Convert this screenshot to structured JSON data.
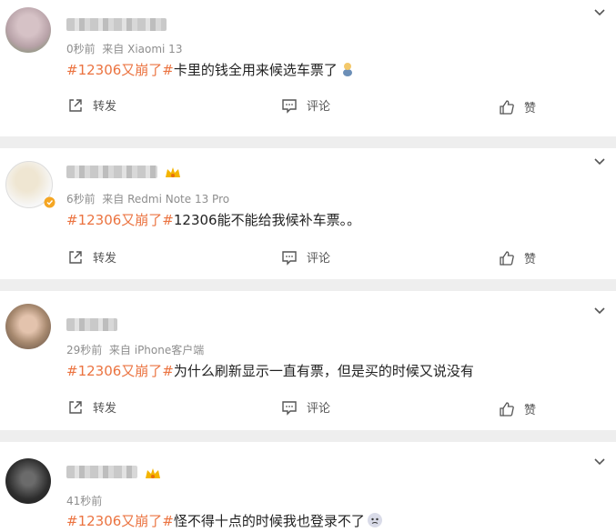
{
  "posts": [
    {
      "time": "0秒前",
      "source": "来自 Xiaomi 13",
      "tag": "#12306又崩了#",
      "text": "卡里的钱全用来候选车票了",
      "actions": {
        "repost": "转发",
        "comment": "评论",
        "like": "赞"
      }
    },
    {
      "time": "6秒前",
      "source": "来自 Redmi Note 13 Pro",
      "tag": "#12306又崩了#",
      "text": "12306能不能给我候补车票。。",
      "actions": {
        "repost": "转发",
        "comment": "评论",
        "like": "赞"
      }
    },
    {
      "time": "29秒前",
      "source": "来自 iPhone客户端",
      "tag": "#12306又崩了#",
      "text": "为什么刷新显示一直有票，但是买的时候又说没有",
      "actions": {
        "repost": "转发",
        "comment": "评论",
        "like": "赞"
      }
    },
    {
      "time": "41秒前",
      "source": "",
      "tag": "#12306又崩了#",
      "text": "怪不得十点的时候我也登录不了"
    }
  ],
  "colors": {
    "topic": "#eb7340",
    "separator": "#eeeeee",
    "meta": "#8e8e8e"
  },
  "icons": {
    "menu": "chevron-down-icon",
    "repost": "share-icon",
    "comment": "comment-icon",
    "like": "thumbs-up-icon"
  }
}
